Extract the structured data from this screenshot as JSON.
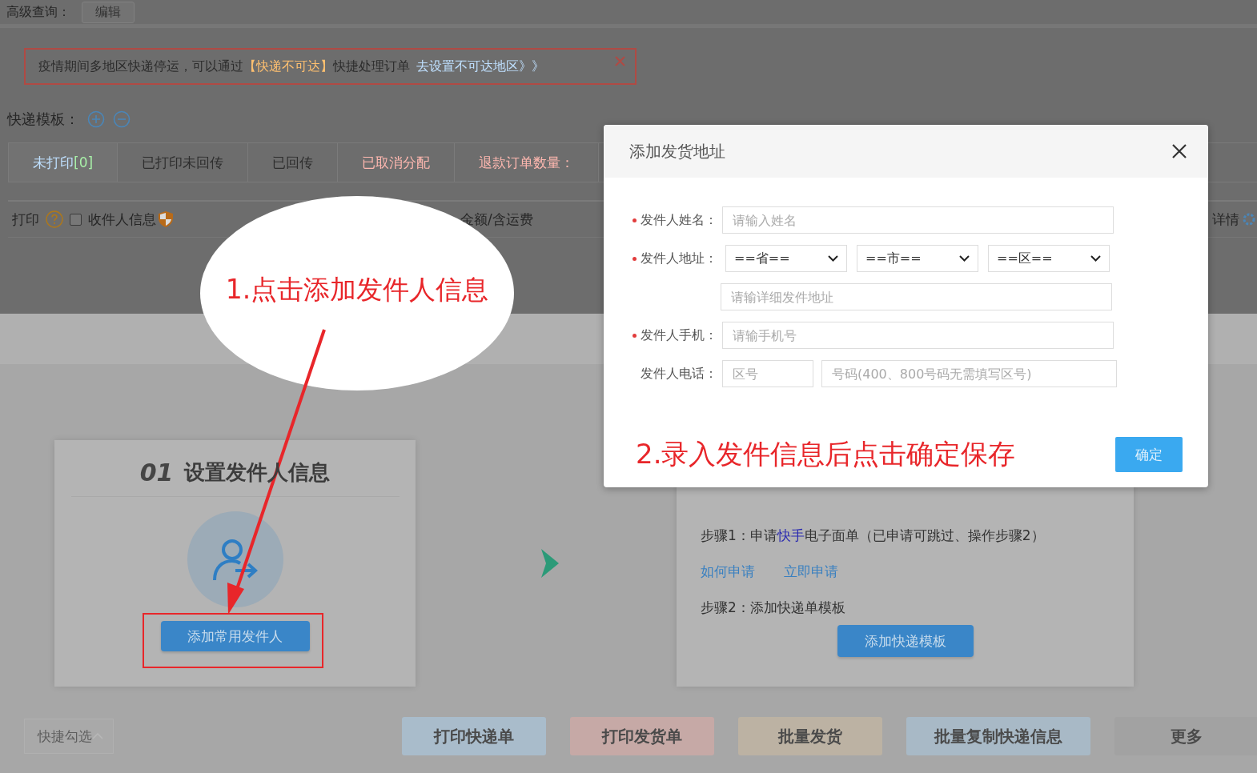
{
  "top_bar": {
    "label": "高级查询：",
    "button": "编辑"
  },
  "notice": {
    "text": "疫情期间多地区快递停运，可以通过",
    "highlight": "【快递不可达】",
    "after": "快捷处理订单",
    "link": "去设置不可达地区》》"
  },
  "templates": {
    "label": "快递模板："
  },
  "tabs": [
    {
      "label": "未打印",
      "count": "[0]",
      "selected": true,
      "color": "#bfe0ff"
    },
    {
      "label": "已打印未回传",
      "selected": false,
      "color": "#2e2e2e"
    },
    {
      "label": "已回传",
      "selected": false,
      "color": "#2e2e2e"
    },
    {
      "label": "已取消分配",
      "selected": false,
      "color": "#ffb8b0"
    },
    {
      "label": "退款订单数量：",
      "selected": false,
      "color": "#ffb8b0"
    }
  ],
  "table_header": {
    "print": "打印",
    "checked": false,
    "receiver": "收件人信息",
    "amount": "金额/含运费",
    "detail": "详情"
  },
  "callout": {
    "text": "1.点击添加发件人信息"
  },
  "cards": [
    {
      "kind": "sender",
      "number": "01",
      "title": "设置发件人信息",
      "button": "添加常用发件人"
    },
    {
      "kind": "steps",
      "step1": {
        "before": "步骤1：申请",
        "highlight": "快手",
        "after": "电子面单（已申请可跳过、操作步骤2）"
      },
      "links": [
        "如何申请",
        "立即申请"
      ],
      "step2": "步骤2：添加快递单模板",
      "button": "添加快递模板"
    }
  ],
  "dialog": {
    "title": "添加发货地址",
    "fields": [
      {
        "kind": "text",
        "label": "发件人姓名：",
        "required": true,
        "placeholder": "请输入姓名"
      },
      {
        "kind": "address",
        "label": "发件人地址：",
        "required": true,
        "selects": [
          "==省==",
          "==市==",
          "==区=="
        ],
        "placeholder": "请输详细发件地址"
      },
      {
        "kind": "text",
        "label": "发件人手机：",
        "required": true,
        "placeholder": "请输手机号"
      },
      {
        "kind": "phone",
        "label": "发件人电话：",
        "required": false,
        "placeholders": [
          "区号",
          "号码(400、800号码无需填写区号)"
        ]
      }
    ],
    "note": "2.录入发件信息后点击确定保存",
    "confirm": "确定"
  },
  "bottom_bar": {
    "quick_select": "快捷勾选",
    "actions": [
      {
        "label": "打印快递单",
        "color": "#a9bccb"
      },
      {
        "label": "打印发货单",
        "color": "#c6a9a6"
      },
      {
        "label": "批量发货",
        "color": "#bcb2a3"
      },
      {
        "label": "批量复制快递信息",
        "color": "#a8b9c6"
      },
      {
        "label": "更多",
        "color": "#a2a2a2"
      }
    ]
  }
}
